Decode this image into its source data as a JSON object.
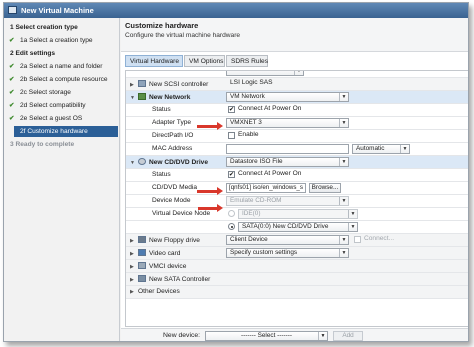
{
  "window": {
    "title": "New Virtual Machine"
  },
  "sidebar": {
    "steps": [
      {
        "text": "1  Select creation type",
        "kind": "head"
      },
      {
        "text": "1a Select a creation type",
        "kind": "done"
      },
      {
        "text": "2  Edit settings",
        "kind": "head"
      },
      {
        "text": "2a Select a name and folder",
        "kind": "done"
      },
      {
        "text": "2b Select a compute resource",
        "kind": "done"
      },
      {
        "text": "2c Select storage",
        "kind": "done"
      },
      {
        "text": "2d Select compatibility",
        "kind": "done"
      },
      {
        "text": "2e Select a guest OS",
        "kind": "done"
      },
      {
        "text": "2f Customize hardware",
        "kind": "active"
      },
      {
        "text": "3  Ready to complete",
        "kind": "muted"
      }
    ]
  },
  "content": {
    "title": "Customize hardware",
    "subtitle": "Configure the virtual machine hardware"
  },
  "tabs": [
    {
      "label": "Virtual Hardware",
      "selected": true
    },
    {
      "label": "VM Options",
      "selected": false
    },
    {
      "label": "SDRS Rules",
      "selected": false
    }
  ],
  "hardware": {
    "scsi": {
      "label": "New SCSI controller",
      "value": "LSI Logic SAS"
    },
    "network": {
      "label": "New Network",
      "value": "VM Network",
      "status_label": "Status",
      "status_value": "Connect At Power On",
      "adapter_label": "Adapter Type",
      "adapter_value": "VMXNET 3",
      "directpath_label": "DirectPath I/O",
      "directpath_value": "Enable",
      "mac_label": "MAC Address",
      "mac_mode": "Automatic"
    },
    "cdrom": {
      "label": "New CD/DVD Drive",
      "value": "Datastore ISO File",
      "status_label": "Status",
      "status_value": "Connect At Power On",
      "media_label": "CD/DVD Media",
      "media_value": "[qnfs01] iso/en_windows_s",
      "browse_label": "Browse...",
      "mode_label": "Device Mode",
      "mode_value": "Emulate CD-ROM",
      "node_label": "Virtual Device Node",
      "node_ide": "IDE(0)",
      "node_sata": "SATA(0:0) New CD/DVD Drive"
    },
    "floppy": {
      "label": "New Floppy drive",
      "value": "Client Device",
      "connect": "Connect..."
    },
    "video": {
      "label": "Video card",
      "value": "Specify custom settings"
    },
    "vmci": {
      "label": "VMCI device"
    },
    "sata": {
      "label": "New SATA Controller"
    },
    "other": {
      "label": "Other Devices"
    }
  },
  "footer": {
    "new_device_label": "New device:",
    "new_device_value": "------- Select -------",
    "add_label": "Add"
  }
}
